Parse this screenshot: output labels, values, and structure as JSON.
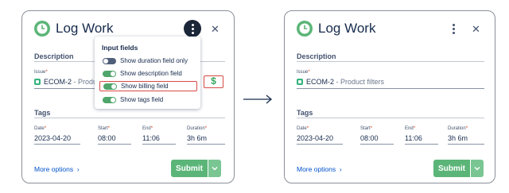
{
  "left": {
    "title": "Log Work",
    "description_label": "Description",
    "issue_label": "Issue",
    "issue_key": "ECOM-2",
    "issue_summary": "Product filters",
    "issue_summary_truncated": "Produ",
    "tags_label": "Tags",
    "date_label": "Date",
    "date_value": "2023-04-20",
    "start_label": "Start",
    "start_value": "08:00",
    "end_label": "End",
    "end_value": "11:06",
    "duration_label": "Duration",
    "duration_value": "3h 6m",
    "more_options": "More options",
    "submit": "Submit",
    "billing_icon": "$",
    "dropdown": {
      "title": "Input fields",
      "options": [
        {
          "label": "Show duration field only",
          "on": false
        },
        {
          "label": "Show description field",
          "on": true
        },
        {
          "label": "Show billing field",
          "on": true,
          "highlighted": true
        },
        {
          "label": "Show tags field",
          "on": true
        }
      ]
    }
  },
  "right": {
    "title": "Log Work",
    "description_label": "Description",
    "issue_label": "Issue",
    "issue_key": "ECOM-2",
    "issue_summary": "Product filters",
    "tags_label": "Tags",
    "date_label": "Date",
    "date_value": "2023-04-20",
    "start_label": "Start",
    "start_value": "08:00",
    "end_label": "End",
    "end_value": "11:06",
    "duration_label": "Duration",
    "duration_value": "3h 6m",
    "more_options": "More options",
    "submit": "Submit"
  },
  "symbols": {
    "required": "*",
    "separator": " - ",
    "close": "✕",
    "chevron_right": "›",
    "chevron_down": "⌄"
  },
  "colors": {
    "accent_green": "#5cb578",
    "link_blue": "#0052cc",
    "highlight_red": "#d84a44",
    "dark_button": "#1b2638"
  }
}
